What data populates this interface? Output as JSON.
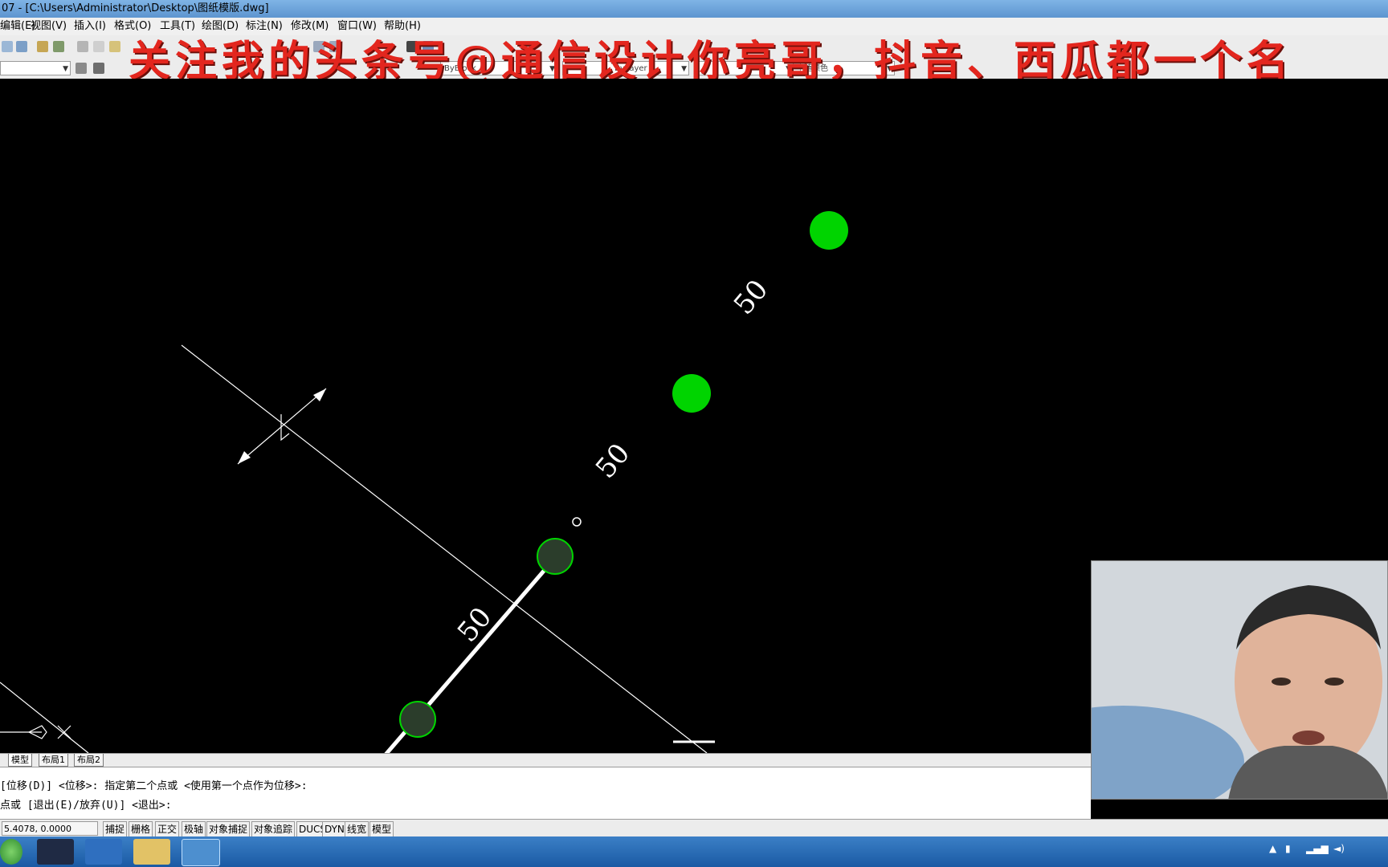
{
  "window": {
    "title": "07 - [C:\\Users\\Administrator\\Desktop\\图纸模版.dwg]"
  },
  "menu": {
    "items": [
      "编辑(E)",
      "视图(V)",
      "插入(I)",
      "格式(O)",
      "工具(T)",
      "绘图(D)",
      "标注(N)",
      "修改(M)",
      "窗口(W)",
      "帮助(H)"
    ]
  },
  "toolbar": {
    "color_combo": "ByBlock",
    "linetype_combo": "ByLayer",
    "lineweight_combo": "",
    "plotstyle_combo": "随颜色"
  },
  "overlay": {
    "text": "关注我的头条号@通信设计你亮哥，抖音、西瓜都一个名"
  },
  "drawing": {
    "dimension_labels": [
      "50",
      "50",
      "50"
    ],
    "colors": {
      "node_bright": "#00d400",
      "node_selected": "#2b3d2b",
      "line": "#ffffff",
      "background": "#000000"
    }
  },
  "tabs": [
    "模型",
    "布局1",
    "布局2"
  ],
  "command": {
    "line1": "[位移(D)] <位移>:  指定第二个点或 <使用第一个点作为位移>:",
    "line2": "点或 [退出(E)/放弃(U)] <退出>:"
  },
  "status": {
    "coords": "5.4078,  0.0000",
    "buttons": [
      "捕捉",
      "栅格",
      "正交",
      "极轴",
      "对象捕捉",
      "对象追踪",
      "DUCS",
      "DYN",
      "线宽",
      "模型"
    ]
  },
  "taskbar": {
    "apps": [
      "start-orb",
      "video-app",
      "browser-app",
      "file-explorer",
      "autocad-app"
    ]
  }
}
